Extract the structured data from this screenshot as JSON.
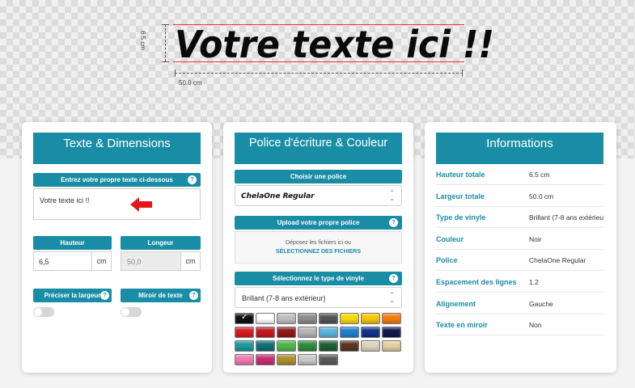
{
  "preview": {
    "text": "Votre texte ici !!",
    "height_label": "6.5 cm",
    "width_label": "50.0 cm"
  },
  "text_panel": {
    "title": "Texte & Dimensions",
    "input_label": "Entrez votre propre texte ci-dessous",
    "input_value": "Votre texte ici !!",
    "height_label": "Hauteur",
    "height_value": "6,5",
    "height_unit": "cm",
    "length_label": "Longeur",
    "length_value": "50,0",
    "length_unit": "cm",
    "width_toggle_label": "Préciser la largeur",
    "mirror_toggle_label": "Miroir de texte",
    "help": "?"
  },
  "font_panel": {
    "title": "Police d'écriture & Couleur",
    "font_label": "Choisir une police",
    "font_value": "ChelaOne Regular",
    "upload_label": "Upload votre propre police",
    "drop_text": "Déposez les fichiers ici ou",
    "select_files": "SÉLECTIONNEZ DES FICHIERS",
    "vinyl_label": "Sélectionnez le type de vinyle",
    "vinyl_value": "Brillant (7-8 ans extérieur)",
    "help": "?",
    "colors": [
      "#111111",
      "#ffffff",
      "#bfbfbf",
      "#8c8c8c",
      "#555555",
      "#f5d90a",
      "#f7c600",
      "#f47a10",
      "#d71920",
      "#c4161c",
      "#8c1a1a",
      "#b5b5b5",
      "#5ab5e0",
      "#1d7fd1",
      "#13328a",
      "#0e1a4e",
      "#1a9a9a",
      "#0d6f75",
      "#4cb749",
      "#2e8b3a",
      "#1b5e34",
      "#5a3422",
      "#ded3bd",
      "#e2cf9f",
      "#f07ab0",
      "#cc2b74",
      "#b08d2c",
      "#c8c8c8",
      "#5a5a5a"
    ]
  },
  "info_panel": {
    "title": "Informations",
    "rows": [
      {
        "label": "Hauteur totale",
        "value": "6.5 cm"
      },
      {
        "label": "Largeur totale",
        "value": "50.0 cm"
      },
      {
        "label": "Type de vinyle",
        "value": "Brillant (7-8 ans extérieur)"
      },
      {
        "label": "Couleur",
        "value": "Noir"
      },
      {
        "label": "Police",
        "value": "ChelaOne Regular"
      },
      {
        "label": "Espacement des lignes",
        "value": "1.2"
      },
      {
        "label": "Alignement",
        "value": "Gauche"
      },
      {
        "label": "Texte en miroir",
        "value": "Non"
      }
    ]
  }
}
